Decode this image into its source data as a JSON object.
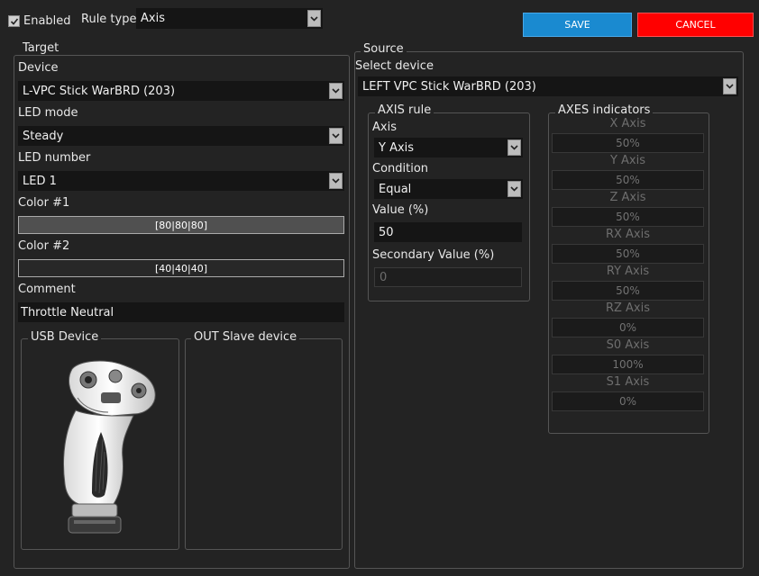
{
  "header": {
    "enabled_label": "Enabled",
    "enabled_checked": true,
    "rule_type_label": "Rule type",
    "rule_type_value": "Axis",
    "save_label": "SAVE",
    "cancel_label": "CANCEL"
  },
  "colors": {
    "save": "#1a8ad0",
    "cancel": "#ff0000",
    "color1": "#505050",
    "color2": "#282828"
  },
  "target": {
    "title": "Target",
    "device_label": "Device",
    "device_value": "L-VPC Stick WarBRD (203)",
    "led_mode_label": "LED mode",
    "led_mode_value": "Steady",
    "led_number_label": "LED number",
    "led_number_value": "LED 1",
    "color1_label": "Color #1",
    "color1_value": "[80|80|80]",
    "color2_label": "Color #2",
    "color2_value": "[40|40|40]",
    "comment_label": "Comment",
    "comment_value": "Throttle Neutral",
    "usb_device_title": "USB Device",
    "out_slave_title": "OUT Slave device"
  },
  "source": {
    "title": "Source",
    "select_device_label": "Select device",
    "select_device_value": "LEFT VPC Stick WarBRD (203)",
    "axis_rule": {
      "title": "AXIS rule",
      "axis_label": "Axis",
      "axis_value": "Y Axis",
      "condition_label": "Condition",
      "condition_value": "Equal",
      "value_label": "Value (%)",
      "value_value": "50",
      "secondary_label": "Secondary Value (%)",
      "secondary_value": "0"
    },
    "indicators": {
      "title": "AXES indicators",
      "axes": [
        {
          "name": "X Axis",
          "value": "50%"
        },
        {
          "name": "Y Axis",
          "value": "50%"
        },
        {
          "name": "Z Axis",
          "value": "50%"
        },
        {
          "name": "RX Axis",
          "value": "50%"
        },
        {
          "name": "RY Axis",
          "value": "50%"
        },
        {
          "name": "RZ Axis",
          "value": "0%"
        },
        {
          "name": "S0 Axis",
          "value": "100%"
        },
        {
          "name": "S1 Axis",
          "value": "0%"
        }
      ]
    }
  }
}
